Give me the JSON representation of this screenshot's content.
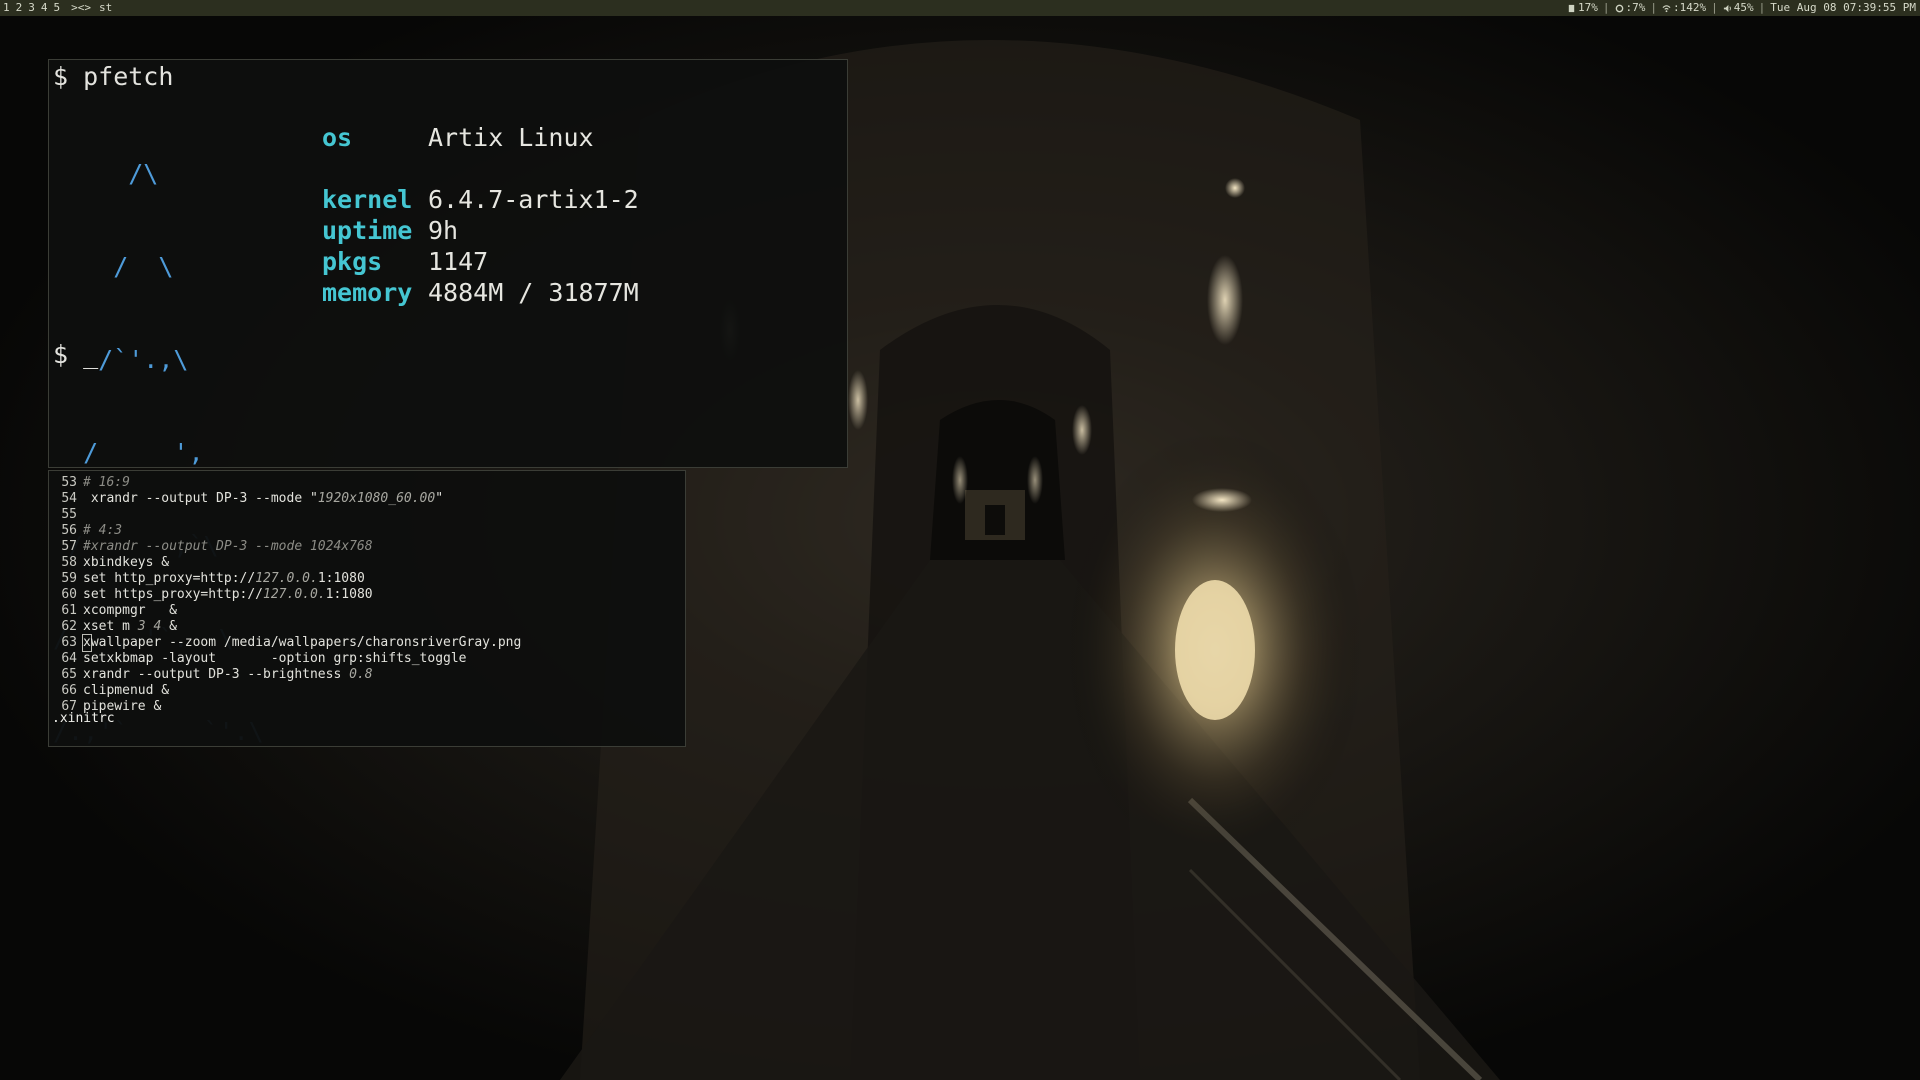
{
  "topbar": {
    "tags": [
      "1",
      "2",
      "3",
      "4",
      "5"
    ],
    "layout": "><>",
    "window_title": "st",
    "status": {
      "disk": "17%",
      "cpu": ":7%",
      "wifi": ":142%",
      "volume": "45%",
      "datetime": "Tue Aug 08 07:39:55 PM",
      "separator": "|",
      "icons": [
        "disk-icon",
        "cpu-icon",
        "wifi-icon",
        "volume-icon"
      ]
    }
  },
  "terminal1": {
    "command": "$ pfetch",
    "logo_lines": [
      "     /\\",
      "    /  \\",
      "   /`'.,\\",
      "  /     ',",
      " /      ,`\\",
      "/   ,.'`.  \\",
      "/.,'`     `'.\\"
    ],
    "info": [
      {
        "key": "os",
        "value": "Artix Linux"
      },
      {
        "key": "",
        "value": ""
      },
      {
        "key": "kernel",
        "value": "6.4.7-artix1-2"
      },
      {
        "key": "uptime",
        "value": "9h"
      },
      {
        "key": "pkgs",
        "value": "1147"
      },
      {
        "key": "memory",
        "value": "4884M / 31877M"
      }
    ],
    "prompt": "$ _",
    "colors": {
      "logo": "#4e9bd9",
      "key": "#45c6d2"
    }
  },
  "terminal2": {
    "lines": [
      {
        "n": "53",
        "parts": [
          {
            "t": "# 16:9",
            "c": "cm"
          }
        ]
      },
      {
        "n": "54",
        "parts": [
          {
            "t": " xrandr --output DP-3 --mode \"",
            "c": ""
          },
          {
            "t": "1920x1080_60.00",
            "c": "it"
          },
          {
            "t": "\"",
            "c": ""
          }
        ]
      },
      {
        "n": "55",
        "parts": [
          {
            "t": "",
            "c": ""
          }
        ]
      },
      {
        "n": "56",
        "parts": [
          {
            "t": "# 4:3",
            "c": "cm"
          }
        ]
      },
      {
        "n": "57",
        "parts": [
          {
            "t": "#xrandr --output DP-3 --mode 1024x768",
            "c": "cm"
          }
        ]
      },
      {
        "n": "58",
        "parts": [
          {
            "t": "xbindkeys &",
            "c": ""
          }
        ]
      },
      {
        "n": "59",
        "parts": [
          {
            "t": "set http_proxy=http://",
            "c": ""
          },
          {
            "t": "127.0.0.",
            "c": "it"
          },
          {
            "t": "1:1080",
            "c": ""
          }
        ]
      },
      {
        "n": "60",
        "parts": [
          {
            "t": "set https_proxy=http://",
            "c": ""
          },
          {
            "t": "127.0.0.",
            "c": "it"
          },
          {
            "t": "1:1080",
            "c": ""
          }
        ]
      },
      {
        "n": "61",
        "parts": [
          {
            "t": "xcompmgr   &",
            "c": ""
          }
        ]
      },
      {
        "n": "62",
        "parts": [
          {
            "t": "xset m ",
            "c": ""
          },
          {
            "t": "3 4",
            "c": "it"
          },
          {
            "t": " &",
            "c": ""
          }
        ]
      },
      {
        "n": "63",
        "parts": [
          {
            "t": "x",
            "c": "cur"
          },
          {
            "t": "wallpaper --zoom /media/wallpapers/charonsriverGray.png",
            "c": ""
          }
        ]
      },
      {
        "n": "64",
        "parts": [
          {
            "t": "setxkbmap -layout       -option grp:shifts_toggle",
            "c": ""
          }
        ]
      },
      {
        "n": "65",
        "parts": [
          {
            "t": "xrandr --output DP-3 --brightness ",
            "c": ""
          },
          {
            "t": "0.8",
            "c": "it"
          }
        ]
      },
      {
        "n": "66",
        "parts": [
          {
            "t": "clipmenud &",
            "c": ""
          }
        ]
      },
      {
        "n": "67",
        "parts": [
          {
            "t": "pipewire &",
            "c": ""
          }
        ]
      }
    ],
    "filename": ".xinitrc"
  }
}
